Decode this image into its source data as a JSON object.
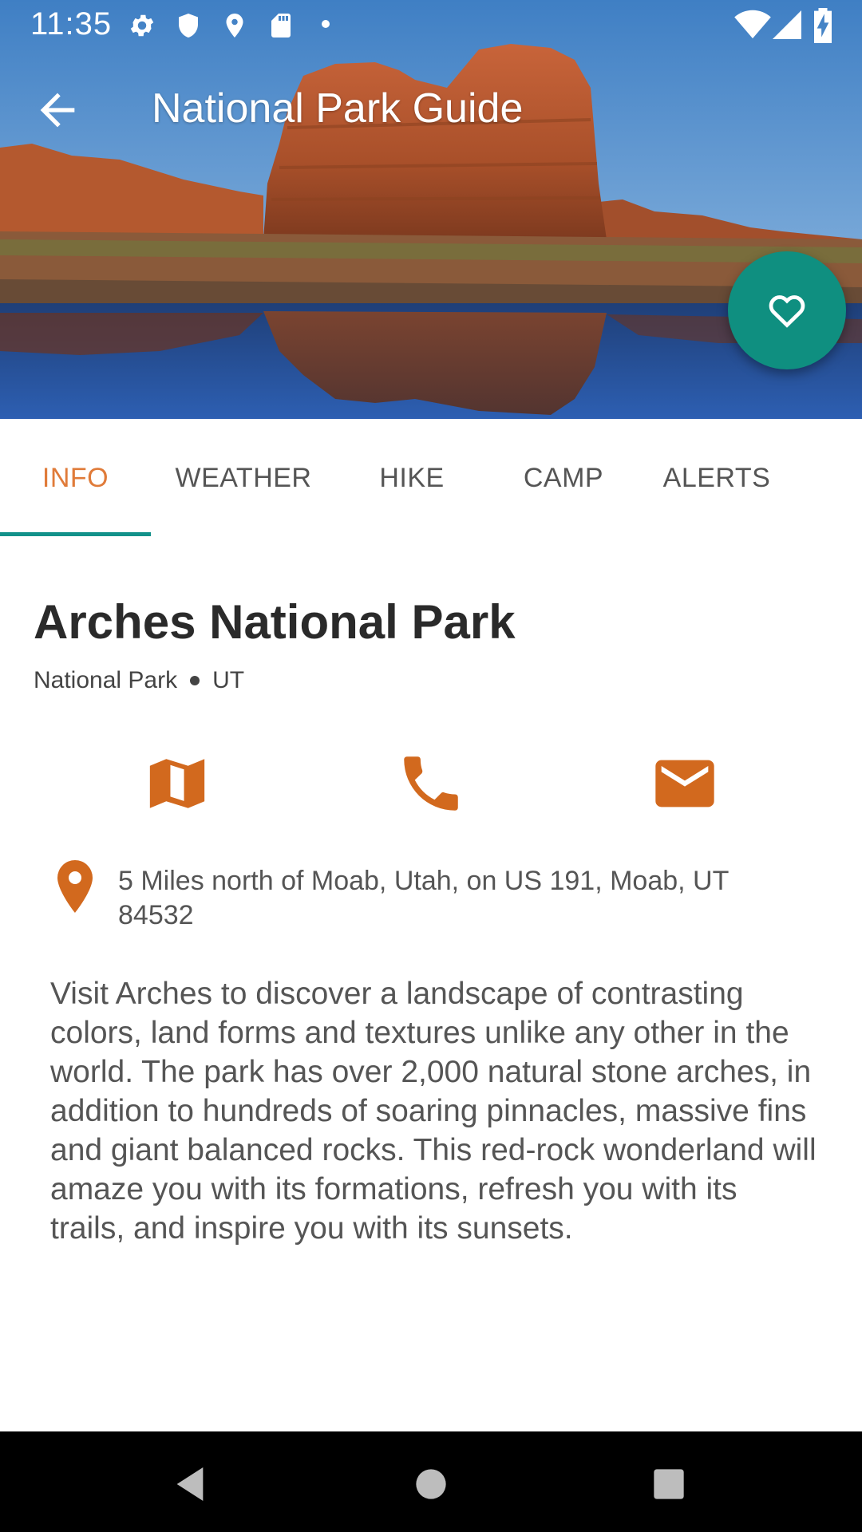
{
  "status_bar": {
    "time": "11:35"
  },
  "app_bar": {
    "title": "National Park Guide"
  },
  "tabs": [
    {
      "label": "INFO",
      "active": true
    },
    {
      "label": "WEATHER",
      "active": false
    },
    {
      "label": "HIKE",
      "active": false
    },
    {
      "label": "CAMP",
      "active": false
    },
    {
      "label": "ALERTS",
      "active": false
    }
  ],
  "park": {
    "name": "Arches National Park",
    "designation": "National Park",
    "state": "UT",
    "address": "5 Miles north of Moab, Utah, on US 191, Moab, UT 84532",
    "description": "Visit Arches to discover a landscape of contrasting colors, land forms and textures unlike any other in the world. The park has over 2,000 natural stone arches, in addition to hundreds of soaring pinnacles, massive fins and giant balanced rocks. This red-rock wonderland will amaze you with its formations, refresh you with its trails, and inspire you with its sunsets."
  },
  "actions": [
    "map-icon",
    "phone-icon",
    "email-icon"
  ],
  "colors": {
    "accent": "#e07b39",
    "fab": "#0f8f80",
    "tab_indicator": "#12918a",
    "action_icon": "#d2691e"
  }
}
